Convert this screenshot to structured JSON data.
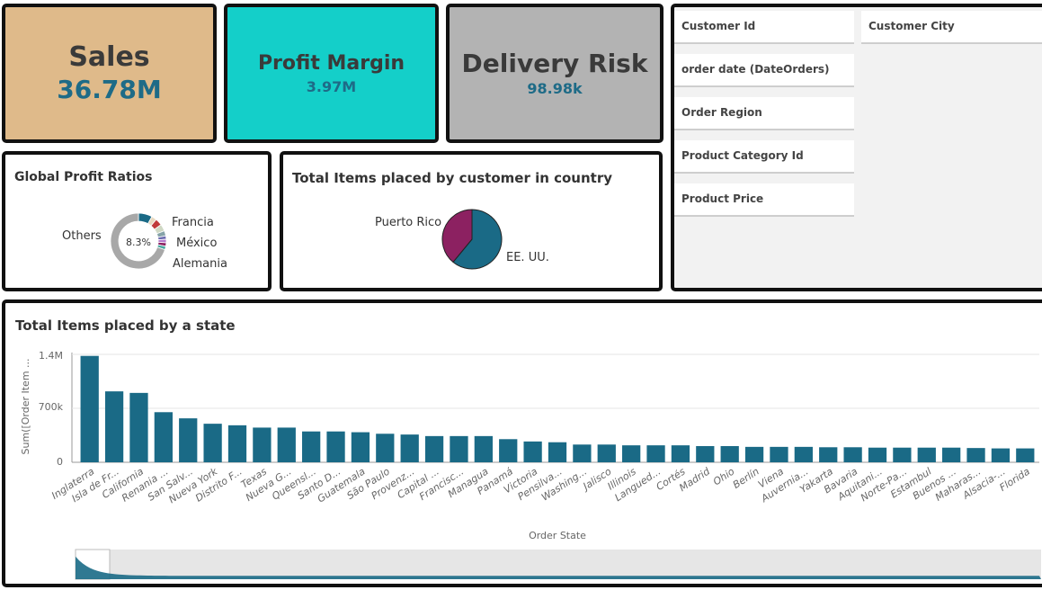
{
  "kpis": {
    "sales": {
      "title": "Sales",
      "value": "36.78M",
      "bg": "#dfba8a"
    },
    "profit_margin": {
      "title": "Profit Margin",
      "value": "3.97M",
      "bg": "#14cfc9"
    },
    "delivery_risk": {
      "title": "Delivery Risk",
      "value": "98.98k",
      "bg": "#b3b3b3"
    }
  },
  "filters": {
    "customer_id": "Customer Id",
    "customer_city": "Customer City",
    "order_date": "order date (DateOrders)",
    "order_region": "Order Region",
    "product_category_id": "Product Category Id",
    "product_price": "Product Price"
  },
  "profit_ratios": {
    "title": "Global Profit Ratios",
    "center_label": "8.3%",
    "label_others": "Others",
    "label_francia": "Francia",
    "label_mexico": "México",
    "label_alemania": "Alemania"
  },
  "customer_country": {
    "title": "Total Items placed by customer in country",
    "label_puerto_rico": "Puerto Rico",
    "label_eeuu": "EE. UU."
  },
  "state_chart": {
    "title": "Total Items placed by a state",
    "y_axis_label": "Sum([Order Item ...",
    "x_axis_label": "Order State",
    "tick_labels": [
      "1.4M",
      "700k",
      "0"
    ]
  },
  "chart_data": [
    {
      "type": "pie",
      "chart": "Global Profit Ratios",
      "donut": true,
      "categories": [
        "Others",
        "Francia",
        "México",
        "Alemania"
      ],
      "center_value": "8.3%"
    },
    {
      "type": "pie",
      "chart": "Total Items placed by customer in country",
      "categories": [
        "EE. UU.",
        "Puerto Rico"
      ],
      "values": [
        61,
        39
      ],
      "colors": [
        "#1a6a86",
        "#8c2161"
      ]
    },
    {
      "type": "bar",
      "title": "Total Items placed by a state",
      "xlabel": "Order State",
      "ylabel": "Sum([Order Item ...",
      "ylim": [
        0,
        1400000
      ],
      "yticks": [
        "0",
        "700k",
        "1.4M"
      ],
      "bar_color": "#1a6a86",
      "categories": [
        "Inglaterra",
        "Isla de Fr...",
        "California",
        "Renania ...",
        "San Salv...",
        "Nueva York",
        "Distrito F...",
        "Texas",
        "Nueva G...",
        "Queensl...",
        "Santo D...",
        "Guatemala",
        "São Paulo",
        "Provenz...",
        "Capital ...",
        "Francisc...",
        "Managua",
        "Panamá",
        "Victoria",
        "Pensilva...",
        "Washing...",
        "Jalisco",
        "Illinois",
        "Langued...",
        "Cortés",
        "Madrid",
        "Ohio",
        "Berlín",
        "Viena",
        "Auvernia...",
        "Yakarta",
        "Bavaria",
        "Aquitani...",
        "Norte-Pa...",
        "Estambul",
        "Buenos ...",
        "Maharas...",
        "Alsacia-...",
        "Florida"
      ],
      "values": [
        1380000,
        920000,
        900000,
        650000,
        570000,
        500000,
        480000,
        450000,
        450000,
        400000,
        400000,
        390000,
        370000,
        360000,
        340000,
        340000,
        340000,
        300000,
        270000,
        260000,
        230000,
        230000,
        220000,
        220000,
        220000,
        210000,
        210000,
        200000,
        200000,
        200000,
        195000,
        195000,
        190000,
        190000,
        190000,
        190000,
        185000,
        180000,
        180000
      ]
    }
  ]
}
